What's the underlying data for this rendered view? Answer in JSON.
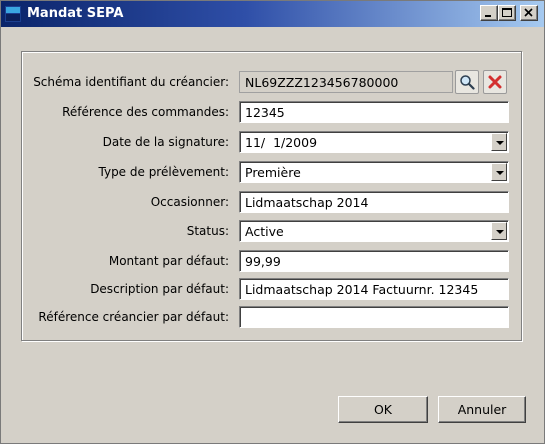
{
  "window": {
    "title": "Mandat SEPA"
  },
  "form": {
    "creditor_scheme": {
      "label": "Schéma identifiant du créancier:",
      "value": "NL69ZZZ123456780000"
    },
    "order_reference": {
      "label": "Référence des commandes:",
      "value": "12345"
    },
    "signature_date": {
      "label": "Date de la signature:",
      "value": "11/  1/2009"
    },
    "debit_type": {
      "label": "Type de prélèvement:",
      "value": "Première"
    },
    "occasion": {
      "label": "Occasionner:",
      "value": "Lidmaatschap 2014"
    },
    "status": {
      "label": "Status:",
      "value": "Active"
    },
    "default_amount": {
      "label": "Montant par défaut:",
      "value": "99,99"
    },
    "default_description": {
      "label": "Description par défaut:",
      "value": "Lidmaatschap 2014 Factuurnr. 12345"
    },
    "default_creditor_reference": {
      "label": "Référence créancier par défaut:",
      "value": ""
    }
  },
  "buttons": {
    "ok": "OK",
    "cancel": "Annuler"
  },
  "icons": {
    "search": "magnifier-icon",
    "delete": "red-x-icon",
    "title": "app-icon"
  },
  "colors": {
    "title_bar": "#0a246a",
    "delete_red": "#d32f2f",
    "dialog_bg": "#d4d0c8"
  }
}
